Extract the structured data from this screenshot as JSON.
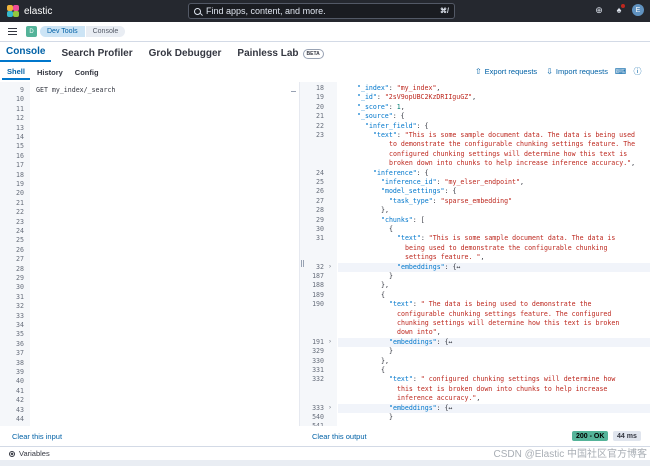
{
  "topbar": {
    "brand": "elastic",
    "search_placeholder": "Find apps, content, and more.",
    "search_shortcut": "⌘/",
    "avatar_initial": "E",
    "logo_colors": [
      "#f0b43c",
      "#f04e98",
      "#36b9cc",
      "#93c83e"
    ]
  },
  "breadcrumbs": {
    "space_initial": "D",
    "items": [
      "Dev Tools",
      "Console"
    ]
  },
  "apptabs": {
    "console": "Console",
    "search_profiler": "Search Profiler",
    "grok_debugger": "Grok Debugger",
    "painless_lab": "Painless Lab",
    "beta": "BETA"
  },
  "subbar": {
    "shell": "Shell",
    "history": "History",
    "config": "Config",
    "export": "Export requests",
    "import": "Import requests"
  },
  "input": {
    "line_numbers": [
      "9",
      "10",
      "11",
      "12",
      "13",
      "14",
      "15",
      "16",
      "17",
      "18",
      "19",
      "20",
      "21",
      "22",
      "23",
      "24",
      "25",
      "26",
      "27",
      "28",
      "29",
      "30",
      "31",
      "32",
      "33",
      "34",
      "35",
      "36",
      "37",
      "38",
      "39",
      "40",
      "41",
      "42",
      "43",
      "44"
    ],
    "request": "GET my_index/_search"
  },
  "output": {
    "lines": [
      {
        "n": "18",
        "indent": 2,
        "t": [
          [
            "k",
            "\"_index\""
          ],
          [
            "p",
            ": "
          ],
          [
            "s",
            "\"my_index\""
          ],
          [
            "p",
            ","
          ]
        ]
      },
      {
        "n": "19",
        "indent": 2,
        "t": [
          [
            "k",
            "\"_id\""
          ],
          [
            "p",
            ": "
          ],
          [
            "s",
            "\"2sV9opUBC2KzDRIIguGZ\""
          ],
          [
            "p",
            ","
          ]
        ]
      },
      {
        "n": "20",
        "indent": 2,
        "t": [
          [
            "k",
            "\"_score\""
          ],
          [
            "p",
            ": "
          ],
          [
            "n",
            "1"
          ],
          [
            "p",
            ","
          ]
        ]
      },
      {
        "n": "21",
        "indent": 2,
        "t": [
          [
            "k",
            "\"_source\""
          ],
          [
            "p",
            ": {"
          ]
        ]
      },
      {
        "n": "22",
        "indent": 3,
        "t": [
          [
            "k",
            "\"infer_field\""
          ],
          [
            "p",
            ": {"
          ]
        ]
      },
      {
        "n": "23",
        "indent": 4,
        "t": [
          [
            "k",
            "\"text\""
          ],
          [
            "p",
            ": "
          ],
          [
            "s",
            "\"This is some sample document data. The data is being used"
          ]
        ]
      },
      {
        "n": "",
        "indent": 6,
        "t": [
          [
            "s",
            "to demonstrate the configurable chunking settings feature. The"
          ]
        ]
      },
      {
        "n": "",
        "indent": 6,
        "t": [
          [
            "s",
            "configured chunking settings will determine how this text is"
          ]
        ]
      },
      {
        "n": "",
        "indent": 6,
        "t": [
          [
            "s",
            "broken down into chunks to help increase inference accuracy.\""
          ],
          [
            "p",
            ","
          ]
        ]
      },
      {
        "n": "24",
        "indent": 4,
        "t": [
          [
            "k",
            "\"inference\""
          ],
          [
            "p",
            ": {"
          ]
        ]
      },
      {
        "n": "25",
        "indent": 5,
        "t": [
          [
            "k",
            "\"inference_id\""
          ],
          [
            "p",
            ": "
          ],
          [
            "s",
            "\"my_elser_endpoint\""
          ],
          [
            "p",
            ","
          ]
        ]
      },
      {
        "n": "26",
        "indent": 5,
        "t": [
          [
            "k",
            "\"model_settings\""
          ],
          [
            "p",
            ": {"
          ]
        ]
      },
      {
        "n": "27",
        "indent": 6,
        "t": [
          [
            "k",
            "\"task_type\""
          ],
          [
            "p",
            ": "
          ],
          [
            "s",
            "\"sparse_embedding\""
          ]
        ]
      },
      {
        "n": "28",
        "indent": 5,
        "t": [
          [
            "p",
            "},"
          ]
        ]
      },
      {
        "n": "29",
        "indent": 5,
        "t": [
          [
            "k",
            "\"chunks\""
          ],
          [
            "p",
            ": ["
          ]
        ]
      },
      {
        "n": "30",
        "indent": 6,
        "t": [
          [
            "p",
            "{"
          ]
        ]
      },
      {
        "n": "31",
        "indent": 7,
        "t": [
          [
            "k",
            "\"text\""
          ],
          [
            "p",
            ": "
          ],
          [
            "s",
            "\"This is some sample document data. The data is"
          ]
        ]
      },
      {
        "n": "",
        "indent": 8,
        "t": [
          [
            "s",
            "being used to demonstrate the configurable chunking"
          ]
        ]
      },
      {
        "n": "",
        "indent": 8,
        "t": [
          [
            "s",
            "settings feature. \""
          ],
          [
            "p",
            ","
          ]
        ]
      },
      {
        "n": "32",
        "indent": 7,
        "fold": true,
        "t": [
          [
            "k",
            "\"embeddings\""
          ],
          [
            "p",
            ": {↔"
          ]
        ]
      },
      {
        "n": "187",
        "indent": 6,
        "t": [
          [
            "p",
            "}"
          ]
        ]
      },
      {
        "n": "188",
        "indent": 5,
        "t": [
          [
            "p",
            "},"
          ]
        ]
      },
      {
        "n": "189",
        "indent": 5,
        "t": [
          [
            "p",
            "{"
          ]
        ]
      },
      {
        "n": "190",
        "indent": 6,
        "t": [
          [
            "k",
            "\"text\""
          ],
          [
            "p",
            ": "
          ],
          [
            "s",
            "\" The data is being used to demonstrate the"
          ]
        ]
      },
      {
        "n": "",
        "indent": 7,
        "t": [
          [
            "s",
            "configurable chunking settings feature. The configured"
          ]
        ]
      },
      {
        "n": "",
        "indent": 7,
        "t": [
          [
            "s",
            "chunking settings will determine how this text is broken"
          ]
        ]
      },
      {
        "n": "",
        "indent": 7,
        "t": [
          [
            "s",
            "down into\""
          ],
          [
            "p",
            ","
          ]
        ]
      },
      {
        "n": "191",
        "indent": 6,
        "fold": true,
        "t": [
          [
            "k",
            "\"embeddings\""
          ],
          [
            "p",
            ": {↔"
          ]
        ]
      },
      {
        "n": "329",
        "indent": 6,
        "t": [
          [
            "p",
            "}"
          ]
        ]
      },
      {
        "n": "330",
        "indent": 5,
        "t": [
          [
            "p",
            "},"
          ]
        ]
      },
      {
        "n": "331",
        "indent": 5,
        "t": [
          [
            "p",
            "{"
          ]
        ]
      },
      {
        "n": "332",
        "indent": 6,
        "t": [
          [
            "k",
            "\"text\""
          ],
          [
            "p",
            ": "
          ],
          [
            "s",
            "\" configured chunking settings will determine how"
          ]
        ]
      },
      {
        "n": "",
        "indent": 7,
        "t": [
          [
            "s",
            "this text is broken down into chunks to help increase"
          ]
        ]
      },
      {
        "n": "",
        "indent": 7,
        "t": [
          [
            "s",
            "inference accuracy.\""
          ],
          [
            "p",
            ","
          ]
        ]
      },
      {
        "n": "333",
        "indent": 6,
        "fold": true,
        "t": [
          [
            "k",
            "\"embeddings\""
          ],
          [
            "p",
            ": {↔"
          ]
        ]
      },
      {
        "n": "540",
        "indent": 6,
        "t": [
          [
            "p",
            "}"
          ]
        ]
      },
      {
        "n": "541",
        "indent": 5,
        "t": [
          [
            "p",
            ""
          ]
        ]
      }
    ]
  },
  "footer": {
    "clear_input": "Clear this input",
    "clear_output": "Clear this output",
    "status_ok": "200 - OK",
    "status_time": "44 ms",
    "variables": "Variables"
  },
  "watermark": "CSDN @Elastic 中国社区官方博客"
}
